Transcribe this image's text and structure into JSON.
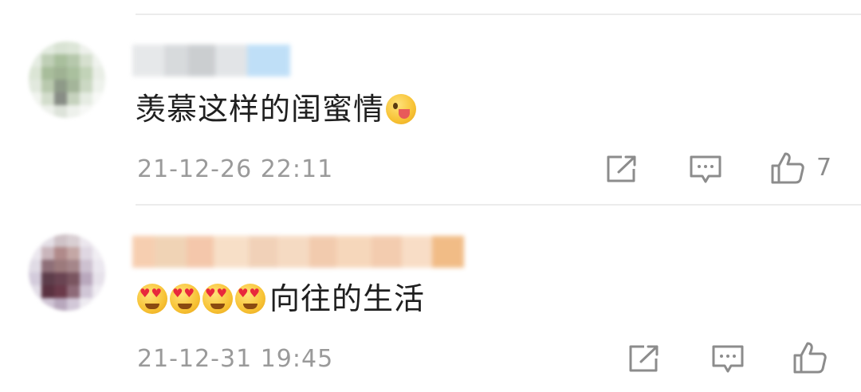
{
  "comments": [
    {
      "text": "羡慕这样的闺蜜情",
      "emoji_icon": "savoring-face-icon",
      "timestamp": "21-12-26 22:11",
      "actions": {
        "share_icon": "share-icon",
        "reply_icon": "comment-icon",
        "like_icon": "thumbs-up-icon",
        "like_count": "7"
      }
    },
    {
      "emoji_icon": "heart-eyes-face-icon",
      "text": "向往的生活",
      "timestamp": "21-12-31 19:45",
      "actions": {
        "share_icon": "share-icon",
        "reply_icon": "comment-icon",
        "like_icon": "thumbs-up-icon",
        "like_count": ""
      }
    }
  ],
  "colors": {
    "text": "#1f1f1f",
    "meta": "#9a9a9a",
    "icon": "#8c8c8c",
    "divider": "#ececec"
  }
}
